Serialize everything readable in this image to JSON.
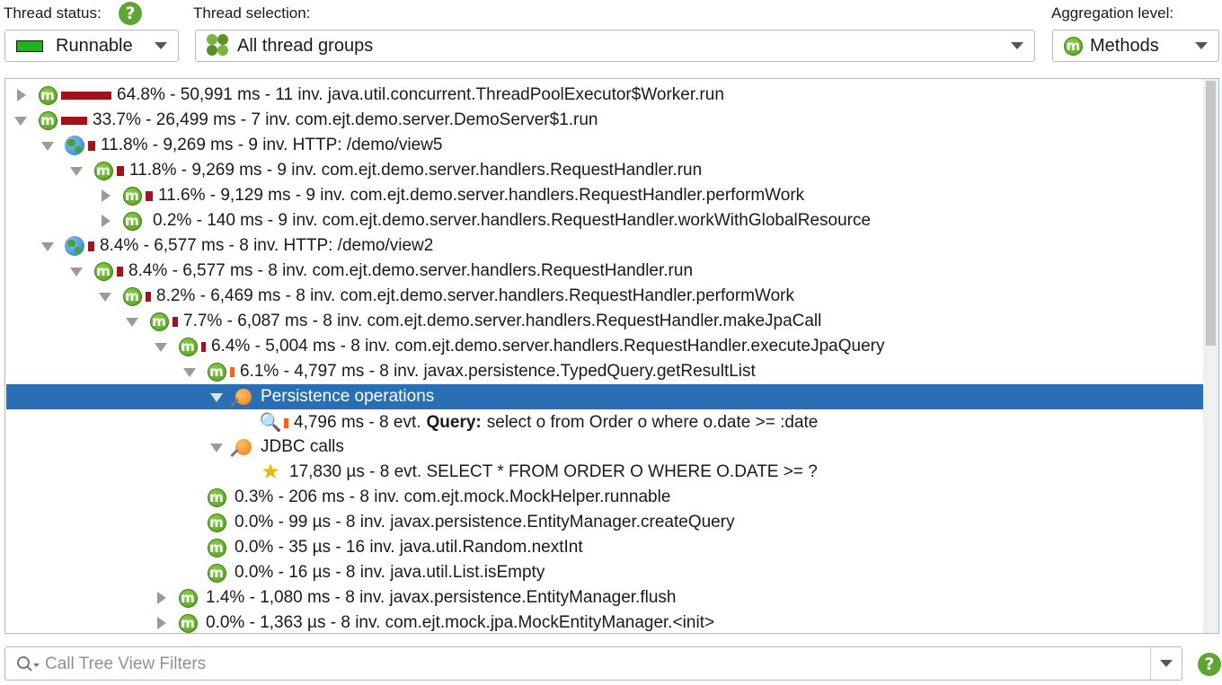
{
  "header": {
    "thread_status_label": "Thread status:",
    "thread_status_value": "Runnable",
    "thread_status_color": "#20b020",
    "thread_selection_label": "Thread selection:",
    "thread_selection_value": "All thread groups",
    "aggregation_label": "Aggregation level:",
    "aggregation_value": "Methods",
    "help_text": "?"
  },
  "tree": {
    "rows": [
      {
        "text": "64.8% - 50,991 ms - 11 inv. java.util.concurrent.ThreadPoolExecutor$Worker.run"
      },
      {
        "text": "33.7% - 26,499 ms - 7 inv. com.ejt.demo.server.DemoServer$1.run"
      },
      {
        "text": "11.8% - 9,269 ms - 9 inv. HTTP: /demo/view5"
      },
      {
        "text": "11.8% - 9,269 ms - 9 inv. com.ejt.demo.server.handlers.RequestHandler.run"
      },
      {
        "text": "11.6% - 9,129 ms - 9 inv. com.ejt.demo.server.handlers.RequestHandler.performWork"
      },
      {
        "text": "0.2% - 140 ms - 9 inv. com.ejt.demo.server.handlers.RequestHandler.workWithGlobalResource"
      },
      {
        "text": "8.4% - 6,577 ms - 8 inv. HTTP: /demo/view2"
      },
      {
        "text": "8.4% - 6,577 ms - 8 inv. com.ejt.demo.server.handlers.RequestHandler.run"
      },
      {
        "text": "8.2% - 6,469 ms - 8 inv. com.ejt.demo.server.handlers.RequestHandler.performWork"
      },
      {
        "text": "7.7% - 6,087 ms - 8 inv. com.ejt.demo.server.handlers.RequestHandler.makeJpaCall"
      },
      {
        "text": "6.4% - 5,004 ms - 8 inv. com.ejt.demo.server.handlers.RequestHandler.executeJpaQuery"
      },
      {
        "text": "6.1% - 4,797 ms - 8 inv. javax.persistence.TypedQuery.getResultList"
      },
      {
        "text": "Persistence operations"
      },
      {
        "text_pre": "4,796 ms - 8 evt.",
        "text_bold": "Query:",
        "text_post": "select o from Order o where o.date >= :date"
      },
      {
        "text": "JDBC calls"
      },
      {
        "text": "17,830 µs - 8 evt. SELECT * FROM ORDER O WHERE O.DATE >= ?"
      },
      {
        "text": "0.3% - 206 ms - 8 inv. com.ejt.mock.MockHelper.runnable"
      },
      {
        "text": "0.0% - 99 µs - 8 inv. javax.persistence.EntityManager.createQuery"
      },
      {
        "text": "0.0% - 35 µs - 16 inv. java.util.Random.nextInt"
      },
      {
        "text": "0.0% - 16 µs - 8 inv. java.util.List.isEmpty"
      },
      {
        "text": "1.4% - 1,080 ms - 8 inv. javax.persistence.EntityManager.flush"
      },
      {
        "text": "0.0% - 1,363 µs - 8 inv. com.ejt.mock.jpa.MockEntityManager.<init>"
      }
    ]
  },
  "filter": {
    "placeholder": "Call Tree View Filters"
  },
  "colors": {
    "selection": "#2a6fb5",
    "bar_red": "#a0131a",
    "bar_orange": "#f0661c",
    "icon_green": "#5fa531"
  }
}
